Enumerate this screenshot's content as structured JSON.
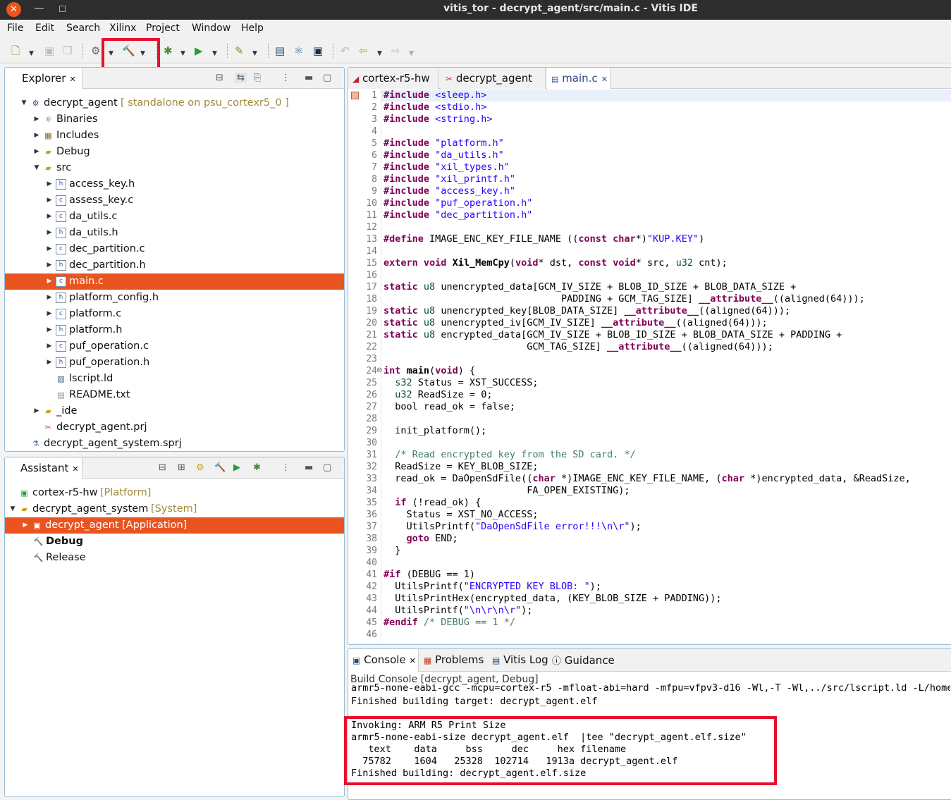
{
  "window": {
    "title": "vitis_tor - decrypt_agent/src/main.c - Vitis IDE"
  },
  "menu": [
    "File",
    "Edit",
    "Search",
    "Xilinx",
    "Project",
    "Window",
    "Help"
  ],
  "explorer": {
    "tab_label": "Explorer",
    "rows": [
      {
        "label": "decrypt_agent",
        "decoration": "[ standalone on psu_cortexr5_0 ]",
        "icon": "project-icon",
        "arrow": "▼"
      },
      {
        "label": "Binaries",
        "icon": "binaries-icon",
        "arrow": "▶"
      },
      {
        "label": "Includes",
        "icon": "includes-icon",
        "arrow": "▶"
      },
      {
        "label": "Debug",
        "icon": "folder-icon",
        "arrow": "▶"
      },
      {
        "label": "src",
        "icon": "folder-icon",
        "arrow": "▼"
      },
      {
        "label": "access_key.h",
        "icon": "h-file-icon",
        "arrow": "▶"
      },
      {
        "label": "assess_key.c",
        "icon": "c-file-icon",
        "arrow": "▶"
      },
      {
        "label": "da_utils.c",
        "icon": "c-file-icon",
        "arrow": "▶"
      },
      {
        "label": "da_utils.h",
        "icon": "h-file-icon",
        "arrow": "▶"
      },
      {
        "label": "dec_partition.c",
        "icon": "c-file-icon",
        "arrow": "▶"
      },
      {
        "label": "dec_partition.h",
        "icon": "h-file-icon",
        "arrow": "▶"
      },
      {
        "label": "main.c",
        "icon": "c-file-icon",
        "arrow": "▶"
      },
      {
        "label": "platform_config.h",
        "icon": "h-file-icon",
        "arrow": "▶"
      },
      {
        "label": "platform.c",
        "icon": "c-file-icon",
        "arrow": "▶"
      },
      {
        "label": "platform.h",
        "icon": "h-file-icon",
        "arrow": "▶"
      },
      {
        "label": "puf_operation.c",
        "icon": "c-file-icon",
        "arrow": "▶"
      },
      {
        "label": "puf_operation.h",
        "icon": "h-file-icon",
        "arrow": "▶"
      },
      {
        "label": "lscript.ld",
        "icon": "linker-icon",
        "arrow": ""
      },
      {
        "label": "README.txt",
        "icon": "text-file-icon",
        "arrow": ""
      },
      {
        "label": "_ide",
        "icon": "folder-icon",
        "arrow": "▶"
      },
      {
        "label": "decrypt_agent.prj",
        "icon": "prj-icon",
        "arrow": ""
      },
      {
        "label": "decrypt_agent_system.sprj",
        "icon": "sprj-icon",
        "arrow": ""
      }
    ]
  },
  "assistant": {
    "tab_label": "Assistant",
    "rows": [
      {
        "label": "cortex-r5-hw",
        "decoration": "[Platform]",
        "arrow": ""
      },
      {
        "label": "decrypt_agent_system",
        "decoration": "[System]",
        "arrow": "▼"
      },
      {
        "label": "decrypt_agent",
        "decoration": "[Application]",
        "arrow": "▶"
      },
      {
        "label": "Debug",
        "decoration": "",
        "arrow": ""
      },
      {
        "label": "Release",
        "decoration": "",
        "arrow": ""
      }
    ]
  },
  "editor": {
    "tabs": [
      "cortex-r5-hw",
      "decrypt_agent",
      "main.c"
    ],
    "line_numbers": [
      "1",
      "2",
      "3",
      "4",
      "5",
      "6",
      "7",
      "8",
      "9",
      "10",
      "11",
      "12",
      "13",
      "14",
      "15",
      "16",
      "17",
      "18",
      "19",
      "20",
      "21",
      "22",
      "23",
      "24",
      "25",
      "26",
      "27",
      "28",
      "29",
      "30",
      "31",
      "32",
      "33",
      "34",
      "35",
      "36",
      "37",
      "38",
      "39",
      "40",
      "41",
      "42",
      "43",
      "44",
      "45",
      "46"
    ]
  },
  "console": {
    "tabs": [
      "Console",
      "Problems",
      "Vitis Log",
      "Guidance"
    ],
    "header": "Build Console [decrypt_agent, Debug]",
    "lines": [
      "armr5-none-eabi-gcc -mcpu=cortex-r5 -mfloat-abi=hard -mfpu=vfpv3-d16 -Wl,-T -Wl,../src/lscript.ld -L/home/",
      "Finished building target: decrypt_agent.elf",
      "",
      "Invoking: ARM R5 Print Size",
      "armr5-none-eabi-size decrypt_agent.elf  |tee \"decrypt_agent.elf.size\"",
      "   text    data     bss     dec     hex filename",
      "  75782    1604   25328  102714   1913a decrypt_agent.elf",
      "Finished building: decrypt_agent.elf.size"
    ]
  },
  "colors": {
    "selection": "#e95420",
    "highlight": "#e8112d",
    "keyword": "#7f0055",
    "string": "#2a00ff",
    "comment": "#3f7f5f"
  }
}
